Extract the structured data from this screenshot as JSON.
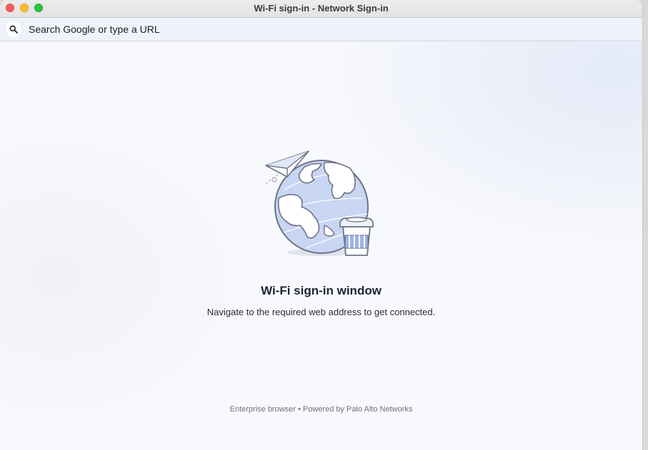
{
  "window": {
    "title": "Wi-Fi sign-in - Network Sign-in"
  },
  "addressbar": {
    "icon": "search-icon",
    "placeholder": "Search Google or type a URL"
  },
  "main": {
    "illustration": "globe-with-paper-plane-and-coffee-illustration",
    "heading": "Wi-Fi sign-in window",
    "subtext": "Navigate to the required web address to get connected."
  },
  "footer": {
    "text": "Enterprise browser • Powered by Palo Alto Networks"
  },
  "colors": {
    "close": "#ff5f57",
    "minimize": "#febc2e",
    "zoom": "#28c840",
    "globe": "#c9d6f3",
    "outline": "#6d7487"
  }
}
